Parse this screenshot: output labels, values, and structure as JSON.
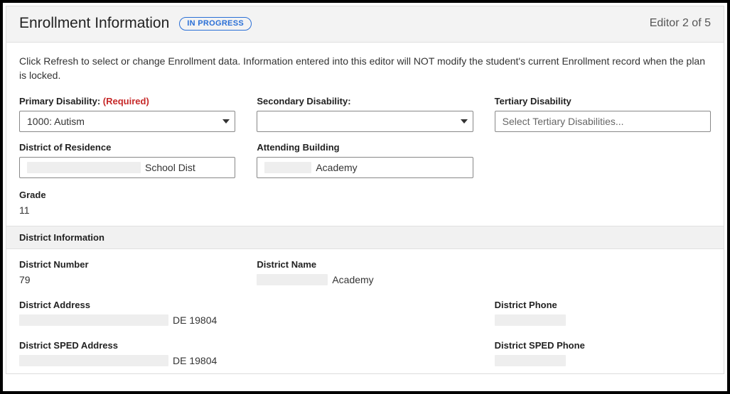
{
  "header": {
    "title": "Enrollment Information",
    "badge": "IN PROGRESS",
    "editor_count": "Editor 2 of 5"
  },
  "instructions": "Click Refresh to select or change Enrollment data. Information entered into this editor will NOT modify the student's current Enrollment record when the plan is locked.",
  "fields": {
    "primary_disability": {
      "label": "Primary Disability:",
      "required_text": "(Required)",
      "value": "1000: Autism"
    },
    "secondary_disability": {
      "label": "Secondary Disability:",
      "value": ""
    },
    "tertiary_disability": {
      "label": "Tertiary Disability",
      "placeholder": "Select Tertiary Disabilities..."
    },
    "district_of_residence": {
      "label": "District of Residence",
      "value_suffix": "School Dist"
    },
    "attending_building": {
      "label": "Attending Building",
      "value_suffix": "Academy"
    },
    "grade": {
      "label": "Grade",
      "value": "11"
    }
  },
  "district_section": {
    "heading": "District Information",
    "district_number": {
      "label": "District Number",
      "value": "79"
    },
    "district_name": {
      "label": "District Name",
      "value_suffix": "Academy"
    },
    "district_address": {
      "label": "District Address",
      "value_suffix": "DE 19804"
    },
    "district_phone": {
      "label": "District Phone"
    },
    "district_sped_address": {
      "label": "District SPED Address",
      "value_suffix": "DE 19804"
    },
    "district_sped_phone": {
      "label": "District SPED Phone"
    }
  }
}
